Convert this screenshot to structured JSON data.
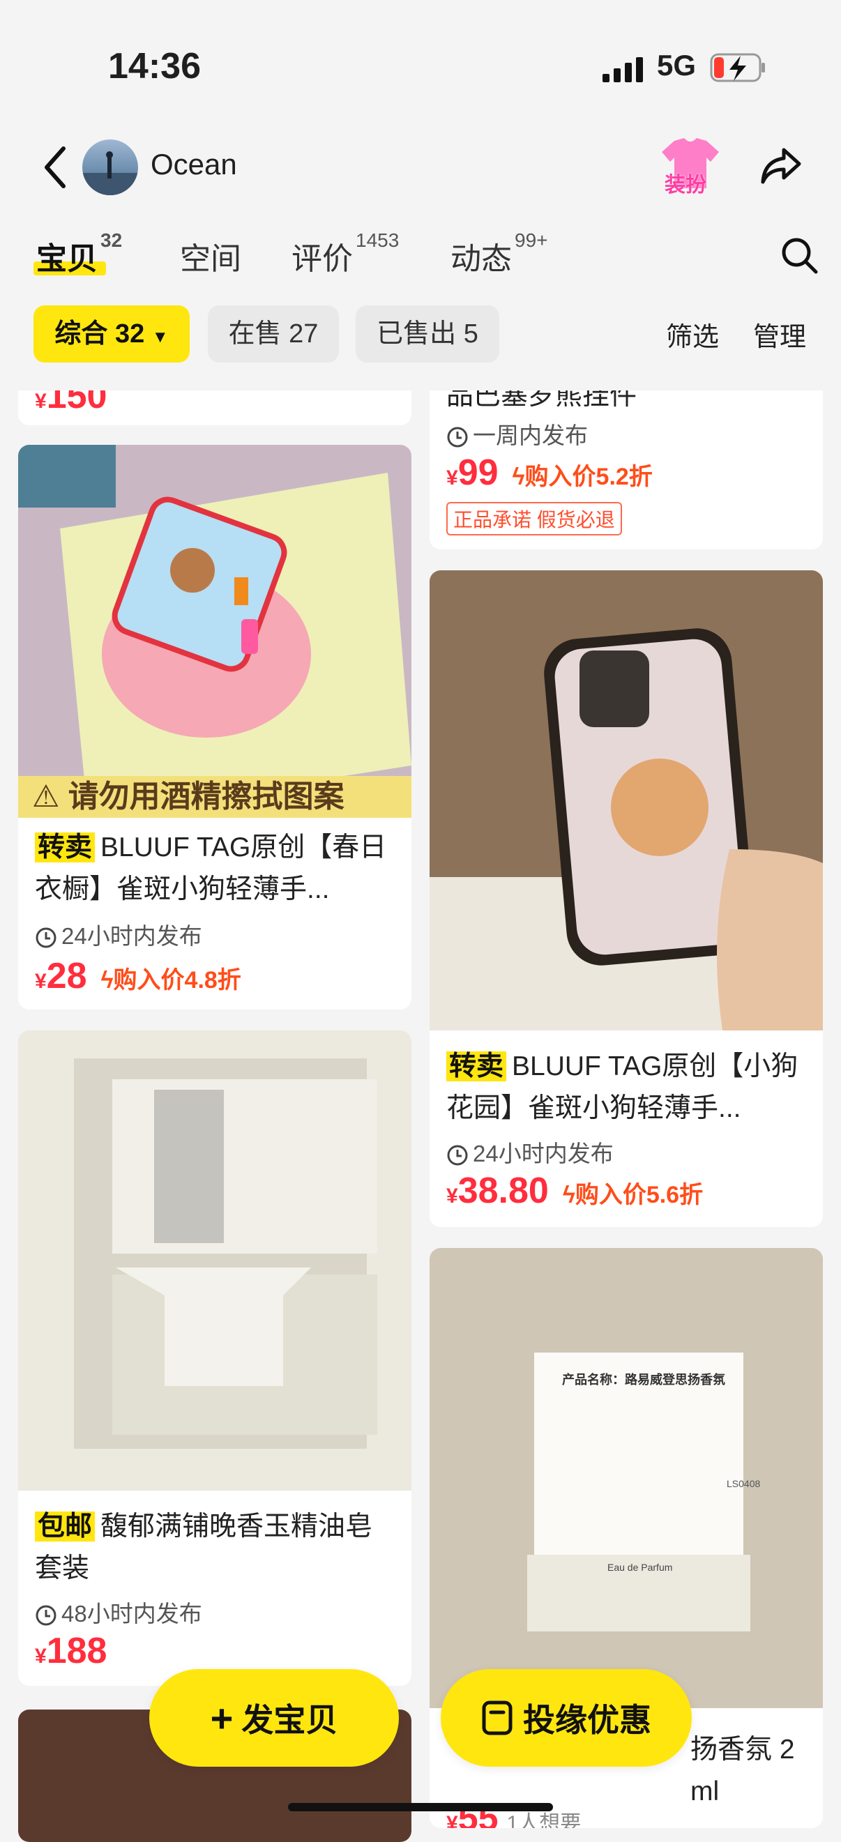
{
  "status": {
    "time": "14:36",
    "network": "5G"
  },
  "header": {
    "username": "Ocean",
    "dress_label": "装扮"
  },
  "tabs": [
    {
      "label": "宝贝",
      "count": "32"
    },
    {
      "label": "空间",
      "count": ""
    },
    {
      "label": "评价",
      "count": "1453"
    },
    {
      "label": "动态",
      "count": "99+"
    }
  ],
  "filters": {
    "chips": [
      "综合 32",
      "在售 27",
      "已售出 5"
    ],
    "screen": "筛选",
    "manage": "管理"
  },
  "left_column": {
    "top_partial_price": "150",
    "cards": [
      {
        "image_banner": "请勿用酒精擦拭图案",
        "tag": "转卖",
        "title": "BLUUF TAG原创【春日衣橱】雀斑小狗轻薄手...",
        "time": "24小时内发布",
        "price": "28",
        "discount": "购入价4.8折"
      },
      {
        "tag": "包邮",
        "title": "馥郁满铺晚香玉精油皂套装",
        "time": "48小时内发布",
        "price": "188"
      }
    ]
  },
  "right_column": {
    "top_partial": {
      "title_tail": "品巴塞罗熊挂件",
      "time": "一周内发布",
      "price": "99",
      "discount": "购入价5.2折",
      "promise": "正品承诺 假货必退"
    },
    "cards": [
      {
        "tag": "转卖",
        "title": "BLUUF TAG原创【小狗花园】雀斑小狗轻薄手...",
        "time": "24小时内发布",
        "price": "38.80",
        "discount": "购入价5.6折"
      },
      {
        "title_partial": "扬香氛 2 ml",
        "price_partial": "55",
        "want": "1人想要",
        "photo_text": {
          "product_name": "产品名称：路易威登思扬香氛",
          "code": "LS0408",
          "perfume": "Eau de Parfum"
        }
      }
    ]
  },
  "fabs": {
    "post": "发宝贝",
    "promo": "投缘优惠"
  },
  "currency": "¥",
  "colors": {
    "accent": "#ffe60f",
    "price": "#ff2d3d"
  }
}
